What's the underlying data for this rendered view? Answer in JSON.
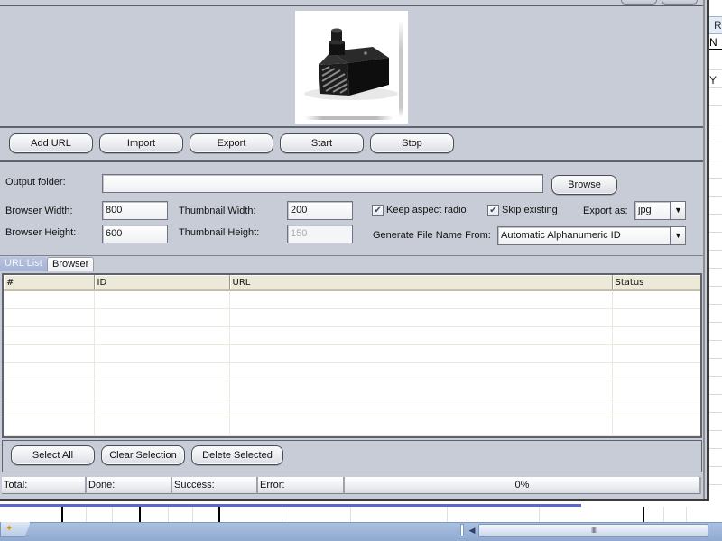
{
  "background_sheet": {
    "column_header_fragment": "R",
    "cell_fragment_1": "N",
    "cell_fragment_2": "Y",
    "scroll_grip": "IIII",
    "scroll_left_arrow": "◀",
    "new_sheet_icon": "✦"
  },
  "toolbar": {
    "buttons": [
      {
        "label": "Add URL"
      },
      {
        "label": "Import"
      },
      {
        "label": "Export"
      },
      {
        "label": "Start"
      },
      {
        "label": "Stop"
      }
    ]
  },
  "settings": {
    "output_folder": {
      "label": "Output folder:",
      "value": ""
    },
    "browse_label": "Browse",
    "browser_width": {
      "label": "Browser Width:",
      "value": "800"
    },
    "browser_height": {
      "label": "Browser Height:",
      "value": "600"
    },
    "thumbnail_width": {
      "label": "Thumbnail Width:",
      "value": "200"
    },
    "thumbnail_height": {
      "label": "Thumbnail Height:",
      "value": "150"
    },
    "keep_aspect": {
      "label": "Keep aspect radio",
      "checked": true
    },
    "skip_existing": {
      "label": "Skip existing",
      "checked": true
    },
    "export_as": {
      "label": "Export as:",
      "value": "jpg"
    },
    "file_name_from": {
      "label": "Generate File Name From:",
      "value": "Automatic Alphanumeric ID"
    },
    "check_glyph": "✔",
    "dropdown_glyph": "▼"
  },
  "tabs": [
    {
      "label": "URL List",
      "active": true
    },
    {
      "label": "Browser",
      "active": false
    }
  ],
  "url_table": {
    "columns": [
      "#",
      "ID",
      "URL",
      "Status"
    ],
    "rows": []
  },
  "bottom_toolbar": {
    "buttons": [
      {
        "label": "Select All"
      },
      {
        "label": "Clear Selection"
      },
      {
        "label": "Delete Selected"
      }
    ]
  },
  "statusbar": {
    "total_label": "Total:",
    "done_label": "Done:",
    "success_label": "Success:",
    "error_label": "Error:",
    "progress_percent": 0,
    "progress_text": "0%"
  },
  "preview": {
    "image_description": "black submersible water pump product thumbnail"
  }
}
